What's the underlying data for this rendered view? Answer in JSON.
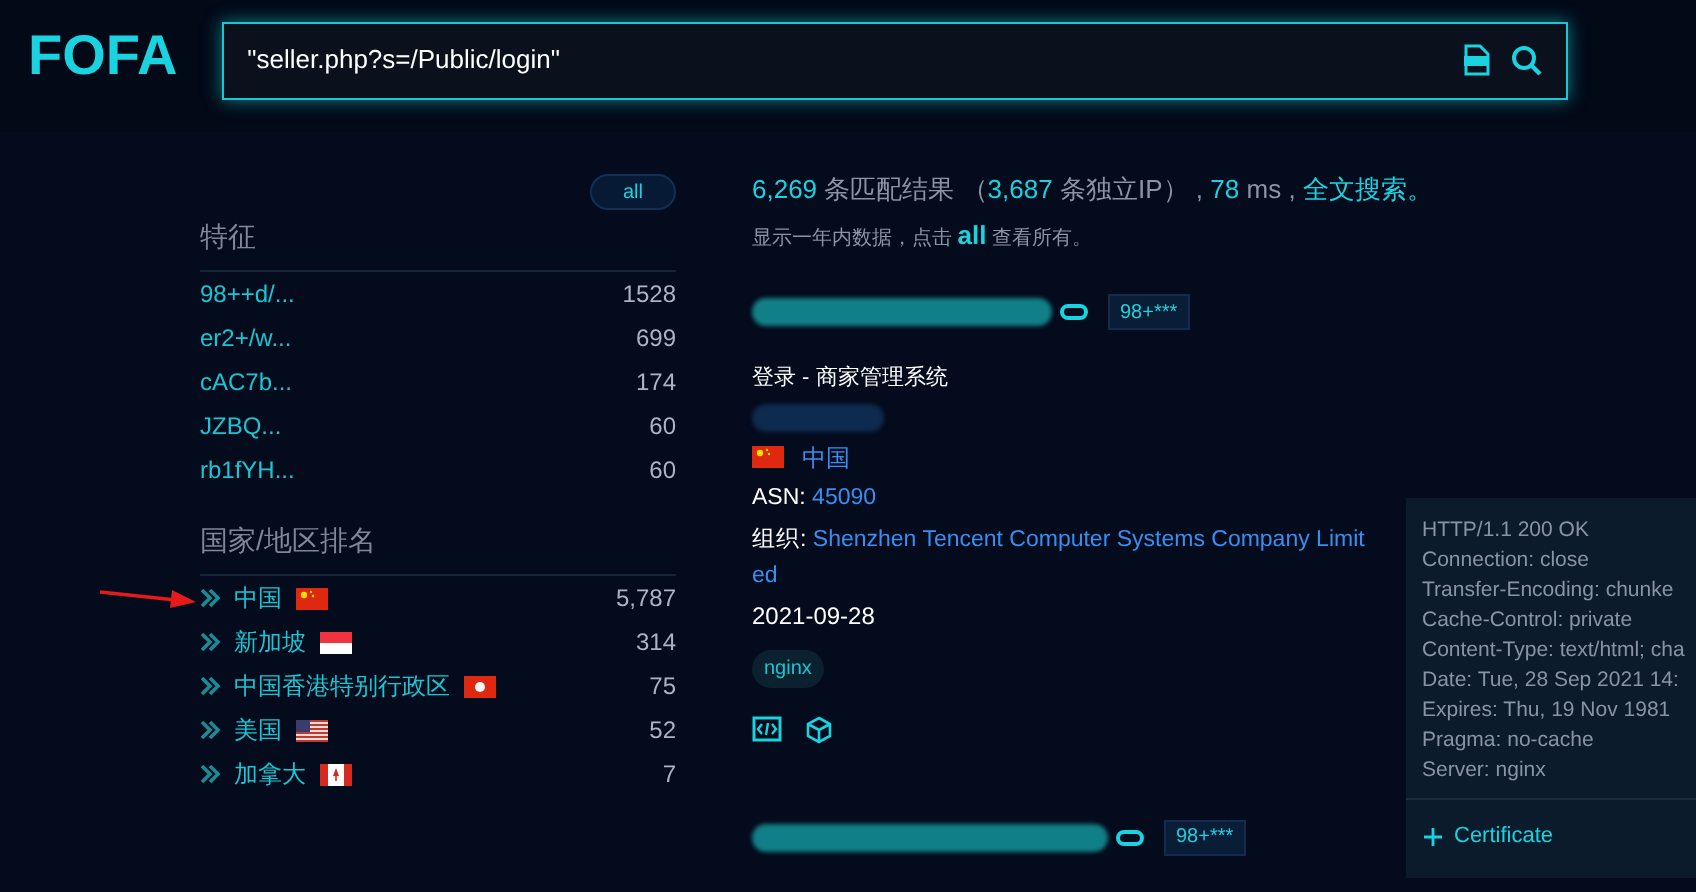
{
  "logo": {
    "text": "FOFA"
  },
  "search": {
    "value": "\"seller.php?s=/Public/login\""
  },
  "sidebar": {
    "all_button": "all",
    "features_title": "特征",
    "features": [
      {
        "label": "98++d/...",
        "count": "1528"
      },
      {
        "label": "er2+/w...",
        "count": "699"
      },
      {
        "label": "cAC7b...",
        "count": "174"
      },
      {
        "label": "JZBQ...",
        "count": "60"
      },
      {
        "label": "rb1fYH...",
        "count": "60"
      }
    ],
    "countries_title": "国家/地区排名",
    "countries": [
      {
        "name": "中国",
        "kind": "cn",
        "count": "5,787"
      },
      {
        "name": "新加坡",
        "kind": "sg",
        "count": "314"
      },
      {
        "name": "中国香港特别行政区",
        "kind": "hk",
        "count": "75"
      },
      {
        "name": "美国",
        "kind": "us",
        "count": "52"
      },
      {
        "name": "加拿大",
        "kind": "ca",
        "count": "7"
      }
    ]
  },
  "summary": {
    "matches": "6,269",
    "matches_label": "条匹配结果",
    "open_paren": "（",
    "unique": "3,687",
    "unique_label": "条独立IP）",
    "comma1": ",",
    "ms": "78",
    "ms_label": "ms",
    "comma2": ",",
    "fulltext": "全文搜索。",
    "note": "显示一年内数据，点击",
    "note_all": "all",
    "note_end": "查看所有。"
  },
  "results": [
    {
      "badge": "98+***",
      "title": "登录 - 商家管理系统",
      "country": "中国",
      "kind": "cn",
      "asn_label": "ASN:",
      "asn": "45090",
      "org_label": "组织:",
      "org": "Shenzhen Tencent Computer Systems Company Limited",
      "date": "2021-09-28",
      "tags": [
        "nginx"
      ],
      "headers": [
        "HTTP/1.1 200 OK",
        "Connection: close",
        "Transfer-Encoding: chunke",
        "Cache-Control: private",
        "Content-Type: text/html; cha",
        "Date: Tue, 28 Sep 2021 14:",
        "Expires: Thu, 19 Nov 1981",
        "Pragma: no-cache",
        "Server: nginx"
      ],
      "certificate": "Certificate"
    },
    {
      "badge": "98+***"
    }
  ]
}
